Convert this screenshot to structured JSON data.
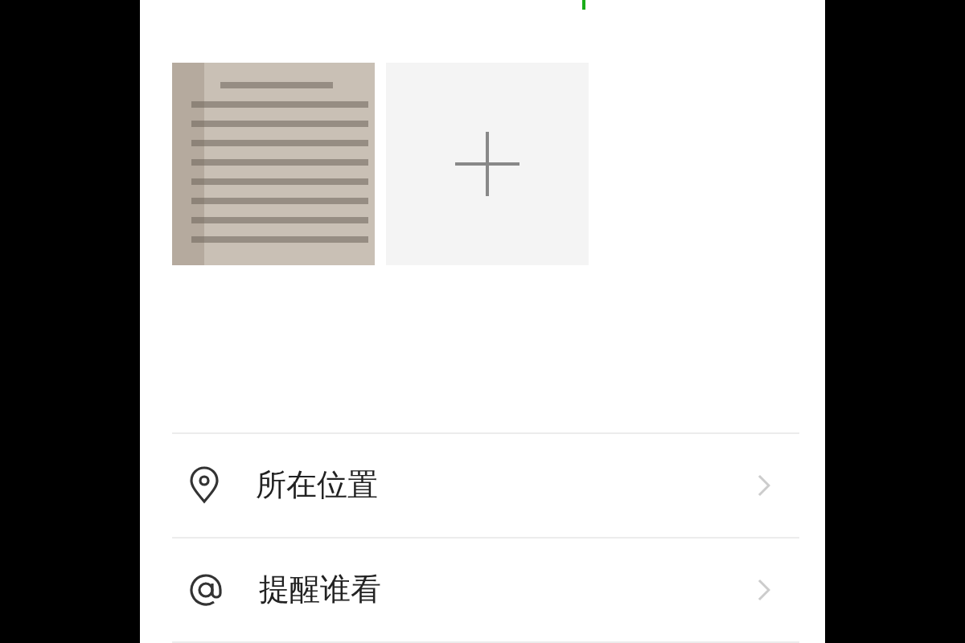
{
  "options": [
    {
      "kind": "location",
      "label": "所在位置"
    },
    {
      "kind": "mention",
      "label": "提醒谁看"
    }
  ]
}
